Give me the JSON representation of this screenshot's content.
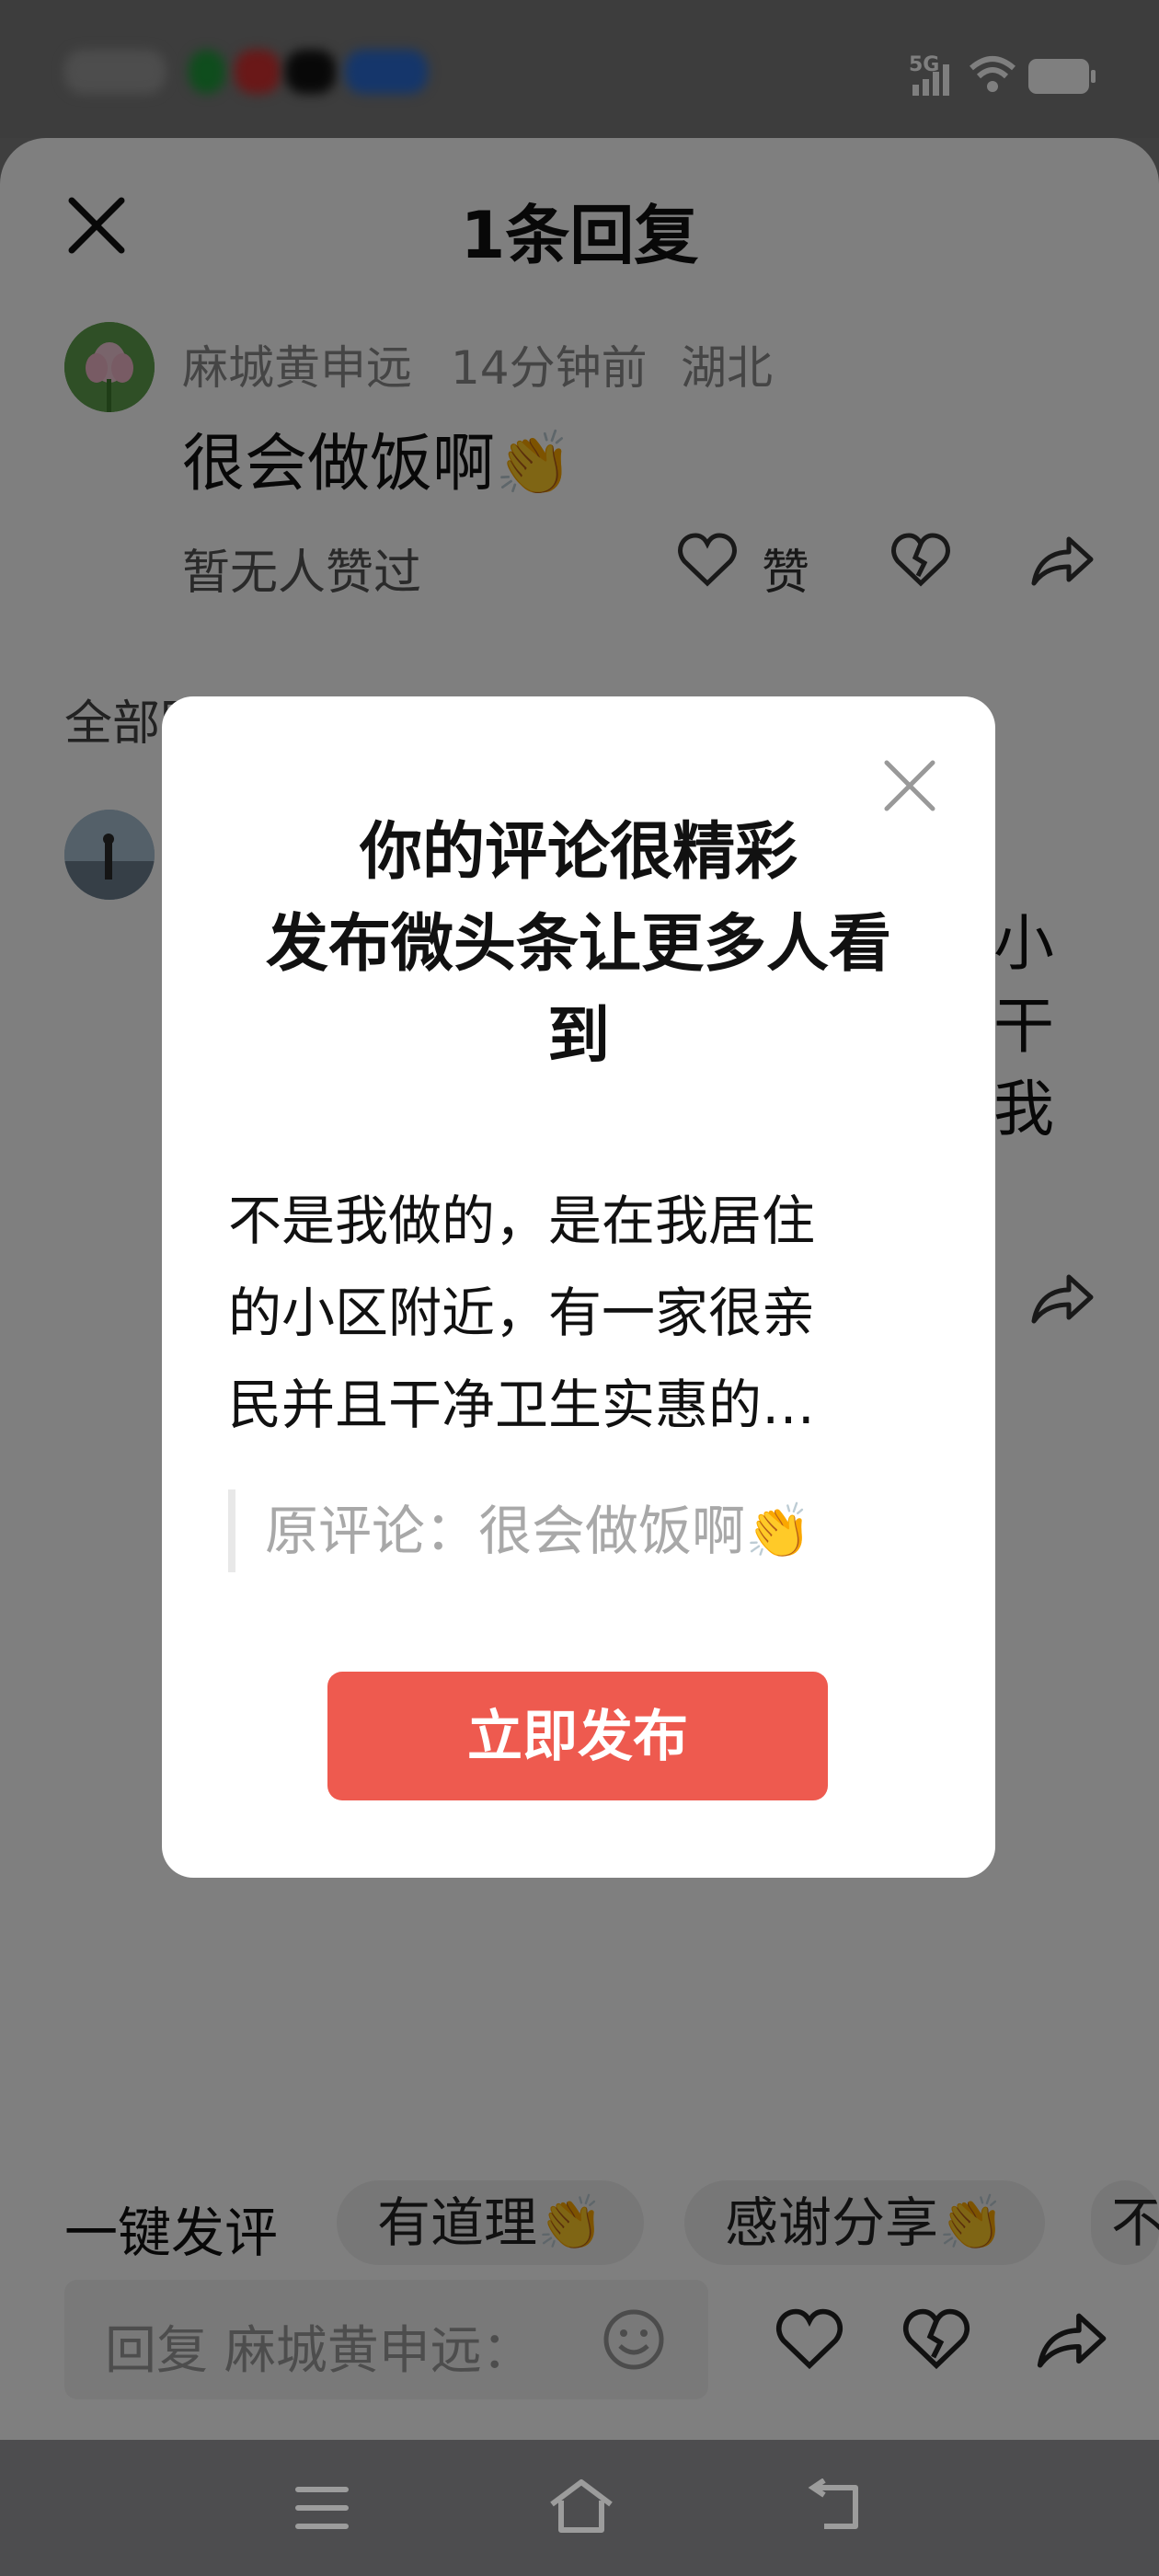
{
  "header": {
    "title": "1条回复"
  },
  "comment": {
    "author": "麻城黄申远",
    "time": "14分钟前",
    "location": "湖北",
    "text": "很会做饭啊👏",
    "likes_text": "暂无人赞过",
    "like_label": "赞"
  },
  "section": {
    "label": "全部回复"
  },
  "reply_partial": {
    "lines": [
      "小",
      "干",
      "我"
    ]
  },
  "quick_replies": {
    "label": "一键发评",
    "chips": [
      "有道理👏",
      "感谢分享👏",
      "不"
    ]
  },
  "reply_input": {
    "placeholder": "回复 麻城黄申远："
  },
  "dialog": {
    "title_line1": "你的评论很精彩",
    "title_line2": "发布微头条让更多人看",
    "title_line3": "到",
    "body_line1": "不是我做的，是在我居住",
    "body_line2": "的小区附近，有一家很亲",
    "body_line3": "民并且干净卫生实惠的…",
    "quote": "原评论：很会做饭啊👏",
    "publish_label": "立即发布"
  },
  "status": {
    "network": "5G"
  },
  "icons": {
    "close": "close-icon",
    "heart": "heart-icon",
    "broken_heart": "broken-heart-icon",
    "share": "share-icon",
    "emoji": "emoji-icon",
    "menu": "menu-icon",
    "home": "home-icon",
    "back": "back-icon"
  },
  "colors": {
    "accent": "#ee5a4f",
    "overlay": "rgba(0,0,0,0.5)"
  }
}
